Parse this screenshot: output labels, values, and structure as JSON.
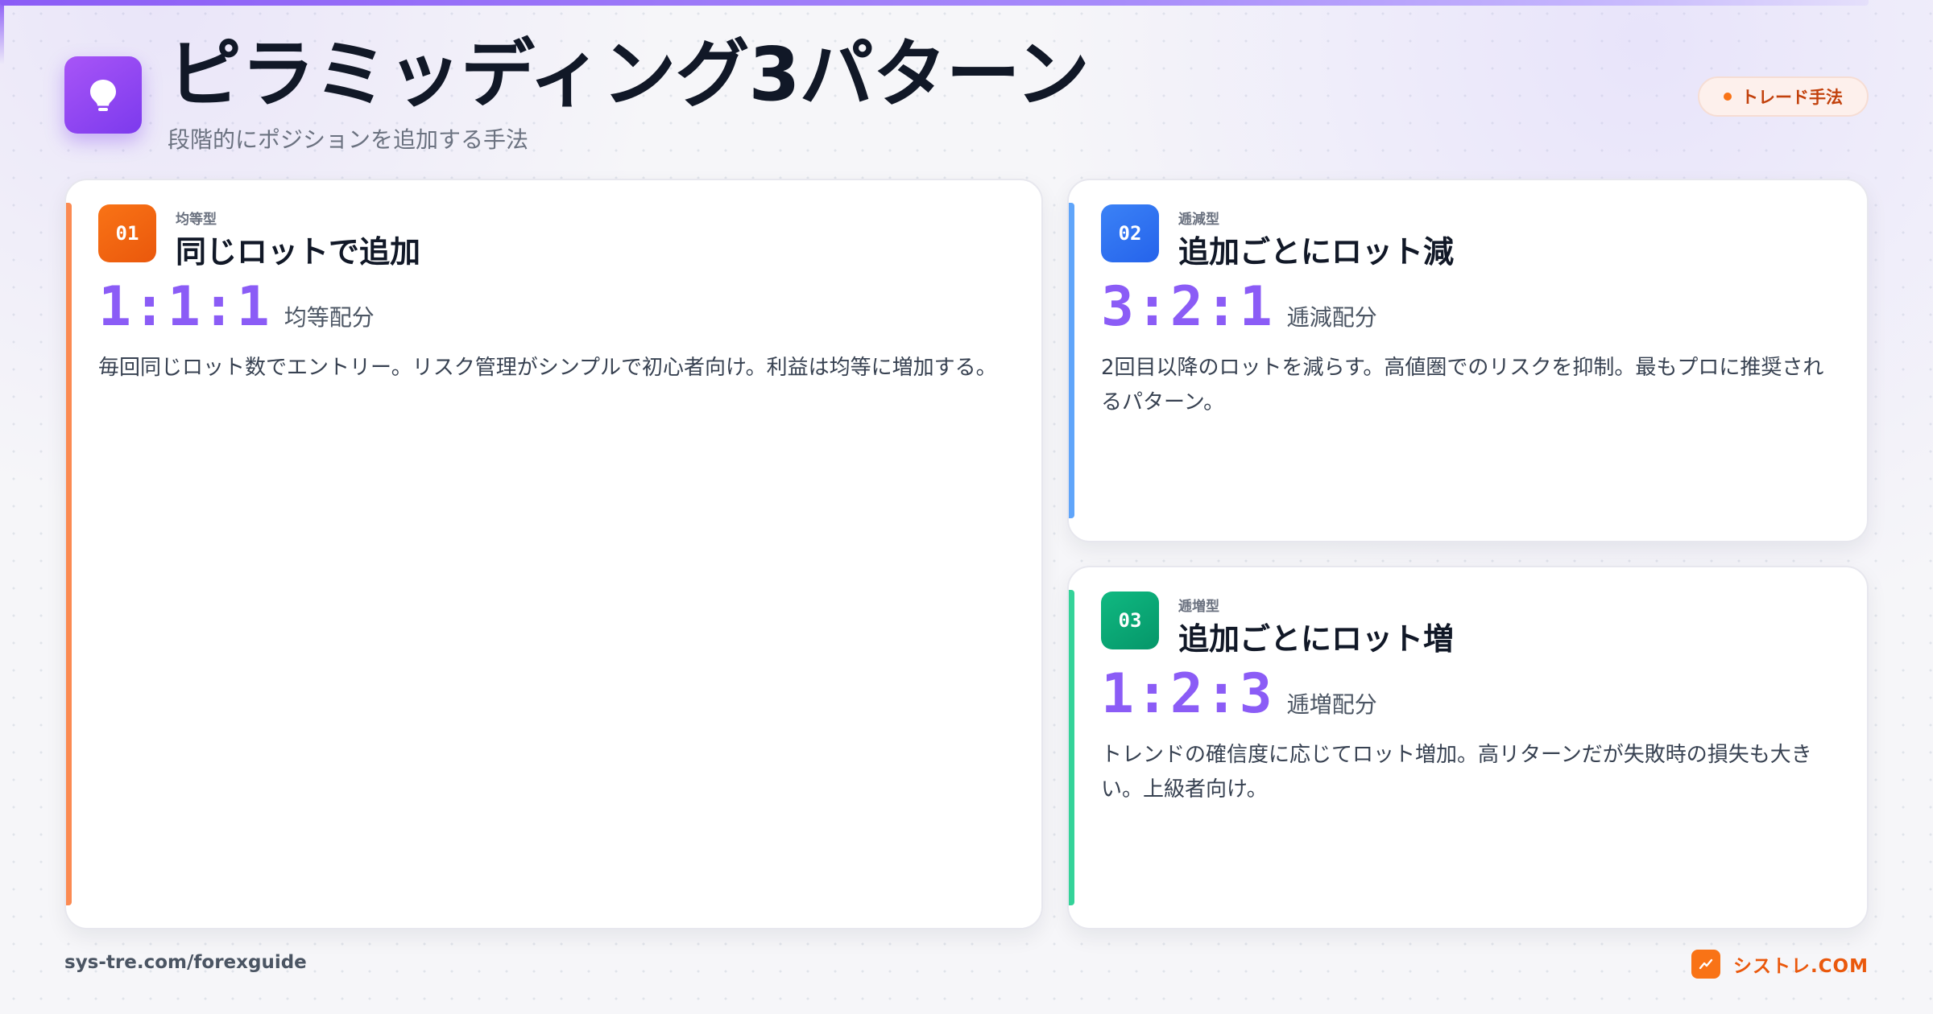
{
  "header": {
    "title": "ピラミッディング3パターン",
    "subtitle": "段階的にポジションを追加する手法",
    "icon": "lightbulb-icon",
    "badge": "トレード手法"
  },
  "cards": [
    {
      "number": "01",
      "type": "均等型",
      "title": "同じロットで追加",
      "ratio": "1:1:1",
      "ratio_label": "均等配分",
      "description": "毎回同じロット数でエントリー。リスク管理がシンプルで初心者向け。利益は均等に増加する。",
      "accent_color": "#f97316"
    },
    {
      "number": "02",
      "type": "逓減型",
      "title": "追加ごとにロット減",
      "ratio": "3:2:1",
      "ratio_label": "逓減配分",
      "description": "2回目以降のロットを減らす。高値圏でのリスクを抑制。最もプロに推奨されるパターン。",
      "accent_color": "#3b82f6"
    },
    {
      "number": "03",
      "type": "逓増型",
      "title": "追加ごとにロット増",
      "ratio": "1:2:3",
      "ratio_label": "逓増配分",
      "description": "トレンドの確信度に応じてロット増加。高リターンだが失敗時の損失も大きい。上級者向け。",
      "accent_color": "#10b981"
    }
  ],
  "footer": {
    "url": "sys-tre.com/forexguide",
    "brand": "シストレ.COM",
    "brand_icon": "trend-chart-icon"
  }
}
